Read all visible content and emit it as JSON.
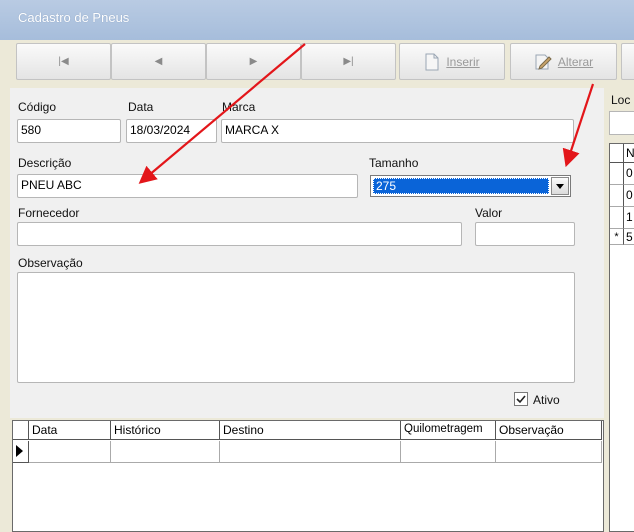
{
  "window": {
    "title": "Cadastro de Pneus"
  },
  "toolbar": {
    "nav_first": "|◀",
    "nav_prev": "◀",
    "nav_next": "▶",
    "nav_last": "▶|",
    "insert_label": "Inserir",
    "edit_label": "Alterar"
  },
  "form": {
    "codigo_label": "Código",
    "codigo_value": "580",
    "data_label": "Data",
    "data_value": "18/03/2024",
    "marca_label": "Marca",
    "marca_value": "MARCA X",
    "descricao_label": "Descrição",
    "descricao_value": "PNEU ABC",
    "tamanho_label": "Tamanho",
    "tamanho_value": "275",
    "fornecedor_label": "Fornecedor",
    "fornecedor_value": "",
    "valor_label": "Valor",
    "valor_value": "",
    "observacao_label": "Observação",
    "observacao_value": "",
    "ativo_label": "Ativo",
    "ativo_checked": true
  },
  "history_grid": {
    "columns": [
      "Data",
      "Histórico",
      "Destino",
      "Quilometragem",
      "Observação"
    ]
  },
  "right_panel": {
    "locate_label": "Loc",
    "grid_header": "N",
    "rows": [
      "0",
      "0",
      "1",
      "5"
    ],
    "new_row_marker": "*"
  },
  "colors": {
    "arrow": "#e3161a",
    "selection": "#0a64d8"
  }
}
